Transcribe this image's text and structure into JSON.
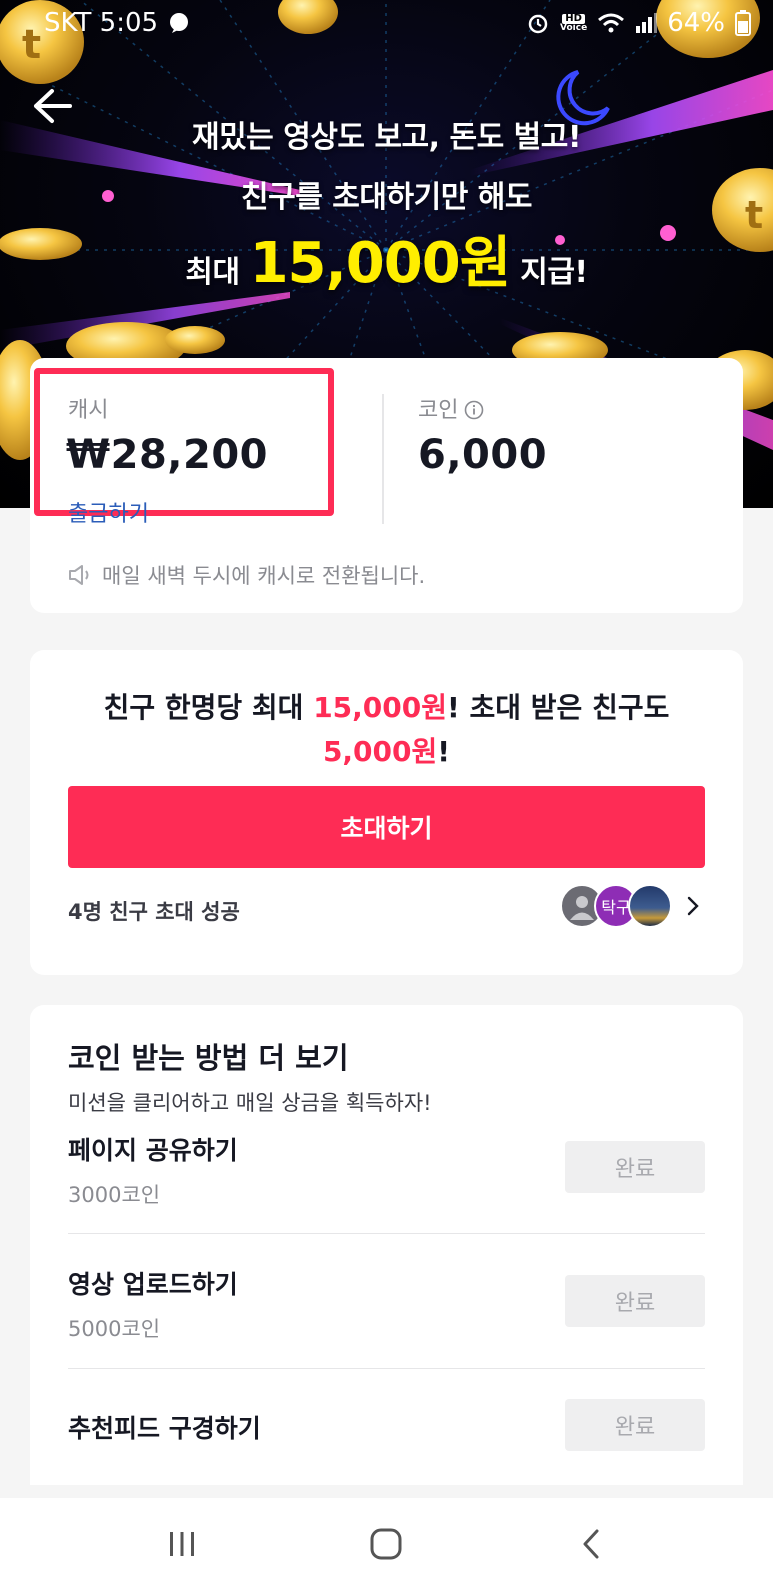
{
  "status_bar": {
    "carrier_time": "SKT 5:05",
    "battery": "64%",
    "hd_label": "HD",
    "voice_label": "Voice"
  },
  "banner": {
    "line1": "재밌는 영상도 보고, 돈도 벌고!",
    "line2": "친구를 초대하기만 해도",
    "line3_prefix": "최대",
    "line3_amount": "15,000원",
    "line3_suffix": "지급!"
  },
  "wallet": {
    "cash_label": "캐시",
    "cash_value": "₩28,200",
    "withdraw_label": "출금하기",
    "coin_label": "코인",
    "coin_value": "6,000",
    "notice": "매일 새벽 두시에 캐시로 전환됩니다."
  },
  "invite": {
    "msg_part1": "친구 한명당 최대 ",
    "msg_amount1": "15,000원",
    "msg_part2": "! 초대 받은 친구도 ",
    "msg_amount2": "5,000원",
    "msg_part3": "!",
    "button_label": "초대하기",
    "success_text": "4명 친구 초대 성공",
    "avatar2_text": "탁구"
  },
  "missions": {
    "title": "코인 받는 방법 더 보기",
    "subtitle": "미션을 클리어하고 매일 상금을 획득하자!",
    "items": [
      {
        "name": "페이지 공유하기",
        "reward": "3000코인",
        "button": "완료"
      },
      {
        "name": "영상 업로드하기",
        "reward": "5000코인",
        "button": "완료"
      },
      {
        "name": "추천피드 구경하기",
        "reward": "",
        "button": "완료"
      }
    ]
  },
  "colors": {
    "accent": "#fe2c55",
    "link": "#2b5db9",
    "banner_amount": "#ffee00"
  }
}
